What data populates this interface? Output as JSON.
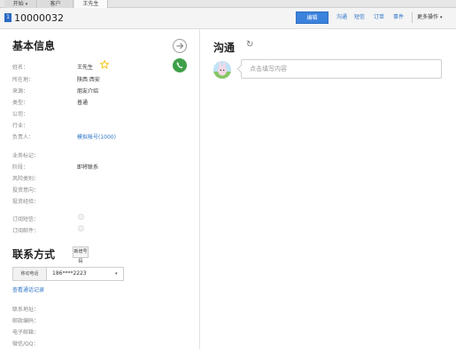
{
  "tabs": [
    {
      "label": "开始",
      "caret": "▾"
    },
    {
      "label": "客户",
      "caret": ""
    },
    {
      "label": "王先生",
      "caret": ""
    }
  ],
  "header": {
    "icon_text": "1",
    "title": "10000032",
    "edit_label": "编辑",
    "links": [
      "沟通",
      "短信",
      "订单",
      "事件"
    ],
    "more_label": "更多操作",
    "more_caret": "▾"
  },
  "basic": {
    "title": "基本信息",
    "star_icon": "star-icon",
    "fields": [
      {
        "label": "姓名：",
        "value": "王先生"
      },
      {
        "label": "所在地：",
        "value": "陕西 西安"
      },
      {
        "label": "来源：",
        "value": "朋友介绍"
      },
      {
        "label": "类型：",
        "value": "普通"
      },
      {
        "label": "公司：",
        "value": ""
      },
      {
        "label": "行业：",
        "value": ""
      },
      {
        "label": "负责人：",
        "value": "模拟帐号(1000)"
      },
      {
        "label": "业务标记：",
        "value": ""
      },
      {
        "label": "阶段：",
        "value": "即将联系"
      },
      {
        "label": "风险类别：",
        "value": ""
      },
      {
        "label": "投资意向：",
        "value": ""
      },
      {
        "label": "投资经验：",
        "value": ""
      },
      {
        "label": "订阅短信：",
        "value": ""
      },
      {
        "label": "订阅邮件：",
        "value": ""
      }
    ]
  },
  "contact": {
    "title": "联系方式",
    "new_phone_label": "新增号码",
    "phone_type": "移动电话",
    "phone_number": "186****2223",
    "phone_caret": "▾",
    "view_more": "查看通话记录",
    "fields": [
      {
        "label": "联系地址："
      },
      {
        "label": "邮政编码："
      },
      {
        "label": "电子邮箱："
      },
      {
        "label": "微信/QQ："
      }
    ]
  },
  "communication": {
    "title": "沟通",
    "refresh_glyph": "↻",
    "placeholder": "点击填写内容"
  },
  "colors": {
    "accent": "#3b82dd",
    "link": "#2d74c8",
    "phone_green": "#3fa049",
    "star": "#f2c200"
  }
}
